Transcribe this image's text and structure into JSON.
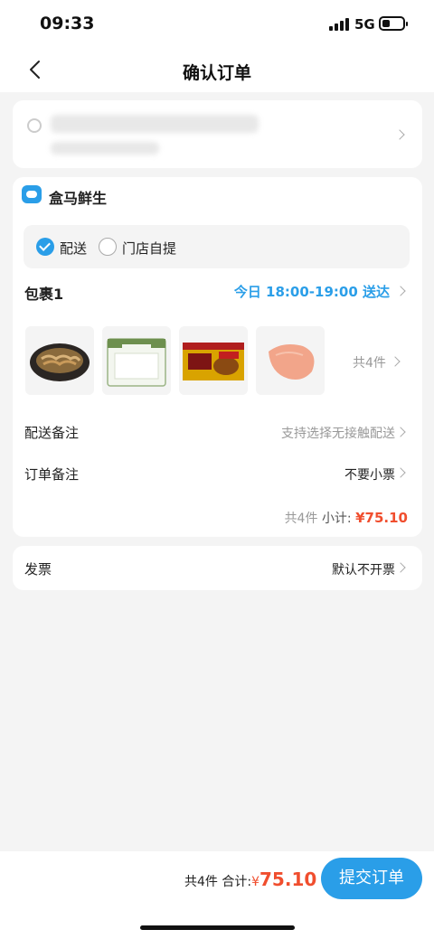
{
  "status_bar": {
    "time": "09:33",
    "network": "5G"
  },
  "nav": {
    "title": "确认订单"
  },
  "store": {
    "name": "盒马鲜生"
  },
  "delivery_mode": {
    "options": [
      "配送",
      "门店自提"
    ],
    "selected": "配送"
  },
  "package": {
    "title": "包裹1",
    "delivery_time": "今日 18:00-19:00 送达",
    "item_count": "共4件",
    "items": [
      "shrimp-product-icon",
      "tofu-product-icon",
      "curry-product-icon",
      "chicken-breast-product-icon"
    ]
  },
  "rows": {
    "delivery_note": {
      "label": "配送备注",
      "value": "支持选择无接触配送"
    },
    "order_note": {
      "label": "订单备注",
      "value": "不要小票"
    }
  },
  "subtotal": {
    "count": "共4件",
    "label": "小计:",
    "price": "¥75.10"
  },
  "invoice": {
    "label": "发票",
    "value": "默认不开票"
  },
  "footer": {
    "count": "共4件",
    "label": "合计:",
    "currency": "¥",
    "amount": "75.10",
    "submit_label": "提交订单"
  },
  "colors": {
    "accent": "#2a9ee8",
    "price": "#f04e2e"
  }
}
